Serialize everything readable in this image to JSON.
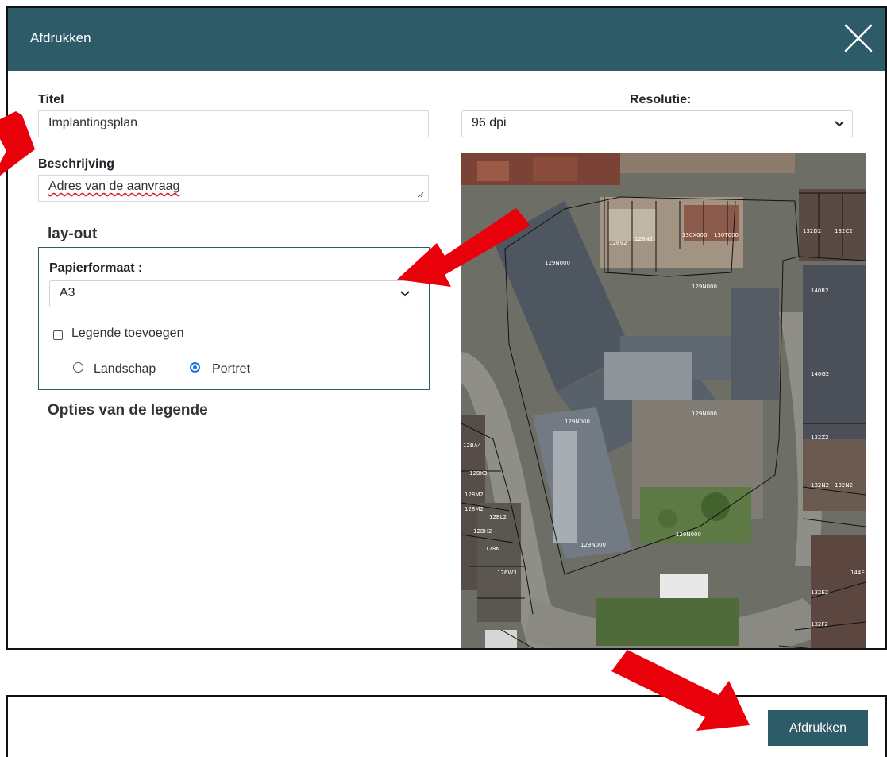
{
  "dialog": {
    "title": "Afdrukken",
    "close_icon": "close-icon"
  },
  "form": {
    "titel_label": "Titel",
    "titel_value": "Implantingsplan",
    "beschrijving_label": "Beschrijving",
    "beschrijving_value_before_cursor": "Adres van de ",
    "beschrijving_value_misspelled": "aanvraag",
    "resolutie_label": "Resolutie:",
    "resolutie_value": "96 dpi"
  },
  "layout": {
    "heading": "lay-out",
    "papierformaat_label": "Papierformaat :",
    "papierformaat_value": "A3",
    "legende_label": "Legende toevoegen",
    "legende_checked": false,
    "orientation_landscape": "Landschap",
    "orientation_portrait": "Portret",
    "orientation_selected": "Portret"
  },
  "legend_options": {
    "heading": "Opties van de legende"
  },
  "map_preview": {
    "parcel_labels": [
      "128V2",
      "128N2",
      "130X000",
      "130T000",
      "132D2",
      "132C2",
      "129N000",
      "129N000",
      "140R2",
      "140G2",
      "129N000",
      "129N000",
      "132Z2",
      "12BA4",
      "12BK3",
      "128M2",
      "128M2",
      "12BL2",
      "12BH2",
      "128N",
      "126W3",
      "129N000",
      "129N000",
      "132E2",
      "132F2",
      "132G2",
      "143A8",
      "132N2",
      "132N2",
      "144E"
    ]
  },
  "footer": {
    "print_button": "Afdrukken"
  },
  "colors": {
    "header": "#2e5b68",
    "button": "#2e5b68",
    "annotation_arrow": "#e8000b",
    "radio_selected": "#1a73e8"
  }
}
